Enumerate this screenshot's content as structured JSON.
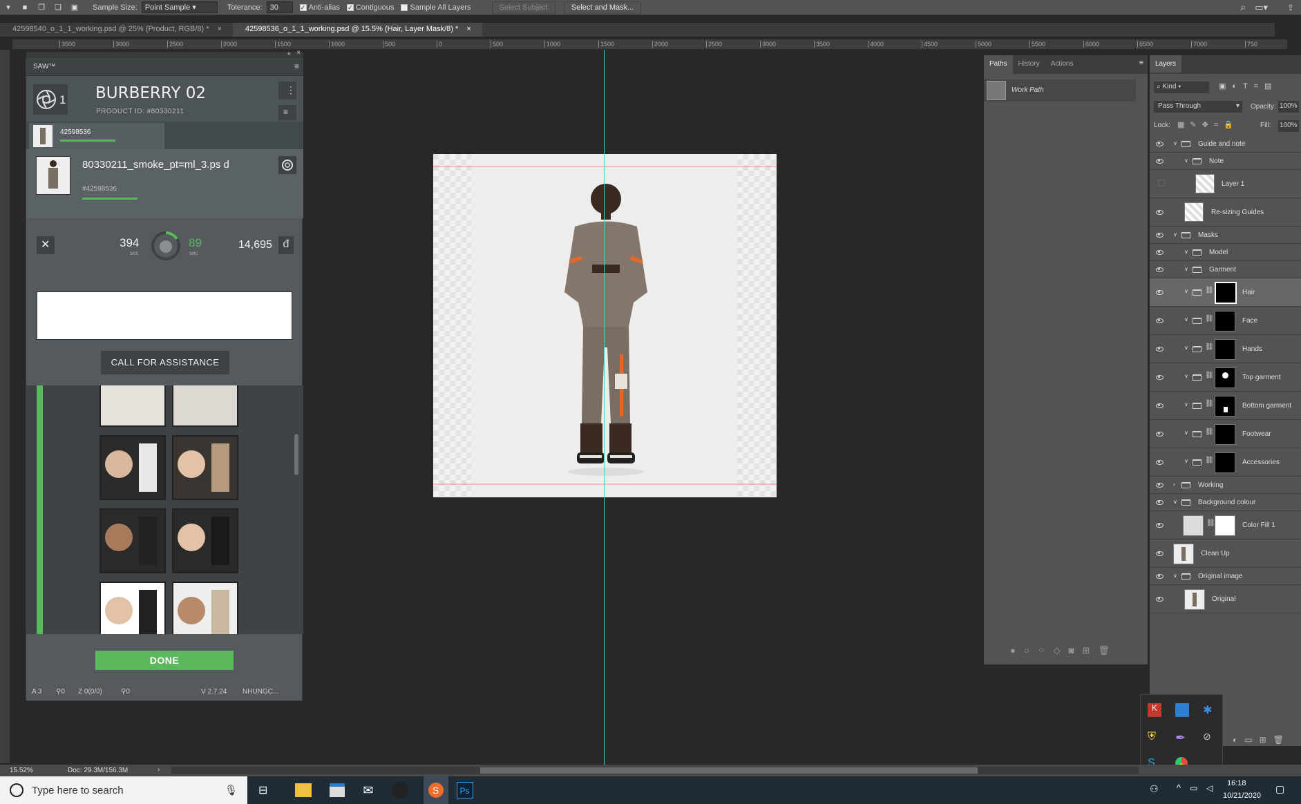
{
  "options_bar": {
    "sample_size_label": "Sample Size:",
    "sample_size_value": "Point Sample",
    "tolerance_label": "Tolerance:",
    "tolerance_value": "30",
    "antialias_label": "Anti-alias",
    "contiguous_label": "Contiguous",
    "sample_all_layers_label": "Sample All Layers",
    "select_subject_label": "Select Subject",
    "select_and_mask_label": "Select and Mask..."
  },
  "tabs": [
    {
      "label": "42598540_o_1_1_working.psd @ 25% (Product, RGB/8) *"
    },
    {
      "label": "42598536_o_1_1_working.psd @ 15.5% (Hair, Layer Mask/8) *"
    }
  ],
  "ruler_ticks": [
    "3500",
    "3000",
    "2500",
    "2000",
    "1500",
    "1000",
    "500",
    "0",
    "500",
    "1000",
    "1500",
    "2000",
    "2500",
    "3000",
    "3500",
    "4000",
    "4500",
    "5000",
    "5500",
    "6000",
    "6500",
    "7000",
    "750"
  ],
  "saw": {
    "title": "SAW™",
    "brand_title": "BURBERRY 02",
    "brand_count": "1",
    "product_id": "PRODUCT ID: #80330211",
    "job_id": "42598536",
    "file_name": "80330211_smoke_pt=ml_3.ps d",
    "file_ref": "#42598536",
    "timer_left": "394",
    "timer_left_unit": "sec",
    "timer_right": "89",
    "timer_right_unit": "sec",
    "points": "14,695",
    "points_symbol": "đ",
    "call_assistance_label": "CALL FOR ASSISTANCE",
    "done_label": "DONE",
    "footer_a": "A 3",
    "footer_b": "0",
    "footer_z": "Z 0(0/0)",
    "footer_c": "0",
    "footer_version": "V 2.7.24",
    "footer_user": "NHUNGC..."
  },
  "paths_panel": {
    "tabs": [
      "Paths",
      "History",
      "Actions"
    ],
    "work_path": "Work Path"
  },
  "layers_panel": {
    "tab": "Layers",
    "filter_kind": "Kind",
    "blend_mode": "Pass Through",
    "opacity_label": "Opacity:",
    "opacity_value": "100%",
    "lock_label": "Lock:",
    "fill_label": "Fill:",
    "fill_value": "100%",
    "layers": [
      {
        "name": "Guide and note",
        "type": "group"
      },
      {
        "name": "Note",
        "type": "group"
      },
      {
        "name": "Layer 1",
        "type": "layer"
      },
      {
        "name": "Re-sizing Guides",
        "type": "layer"
      },
      {
        "name": "Masks",
        "type": "group"
      },
      {
        "name": "Model",
        "type": "group"
      },
      {
        "name": "Garment",
        "type": "group"
      },
      {
        "name": "Hair",
        "type": "mask"
      },
      {
        "name": "Face",
        "type": "mask"
      },
      {
        "name": "Hands",
        "type": "mask"
      },
      {
        "name": "Top garment",
        "type": "mask"
      },
      {
        "name": "Bottom garment",
        "type": "mask"
      },
      {
        "name": "Footwear",
        "type": "mask"
      },
      {
        "name": "Accessories",
        "type": "mask"
      },
      {
        "name": "Working",
        "type": "group"
      },
      {
        "name": "Background colour",
        "type": "group"
      },
      {
        "name": "Color Fill 1",
        "type": "fill"
      },
      {
        "name": "Clean Up",
        "type": "layer"
      },
      {
        "name": "Original image",
        "type": "group"
      },
      {
        "name": "Original",
        "type": "layer"
      }
    ]
  },
  "status": {
    "zoom": "15.52%",
    "doc": "Doc: 29.3M/156.3M"
  },
  "taskbar": {
    "search_placeholder": "Type here to search",
    "time": "16:18",
    "date": "10/21/2020"
  },
  "colors": {
    "guide": "#3fd2d7",
    "saw_green": "#5cb85c",
    "accent_selection": "#5a5a5a"
  }
}
